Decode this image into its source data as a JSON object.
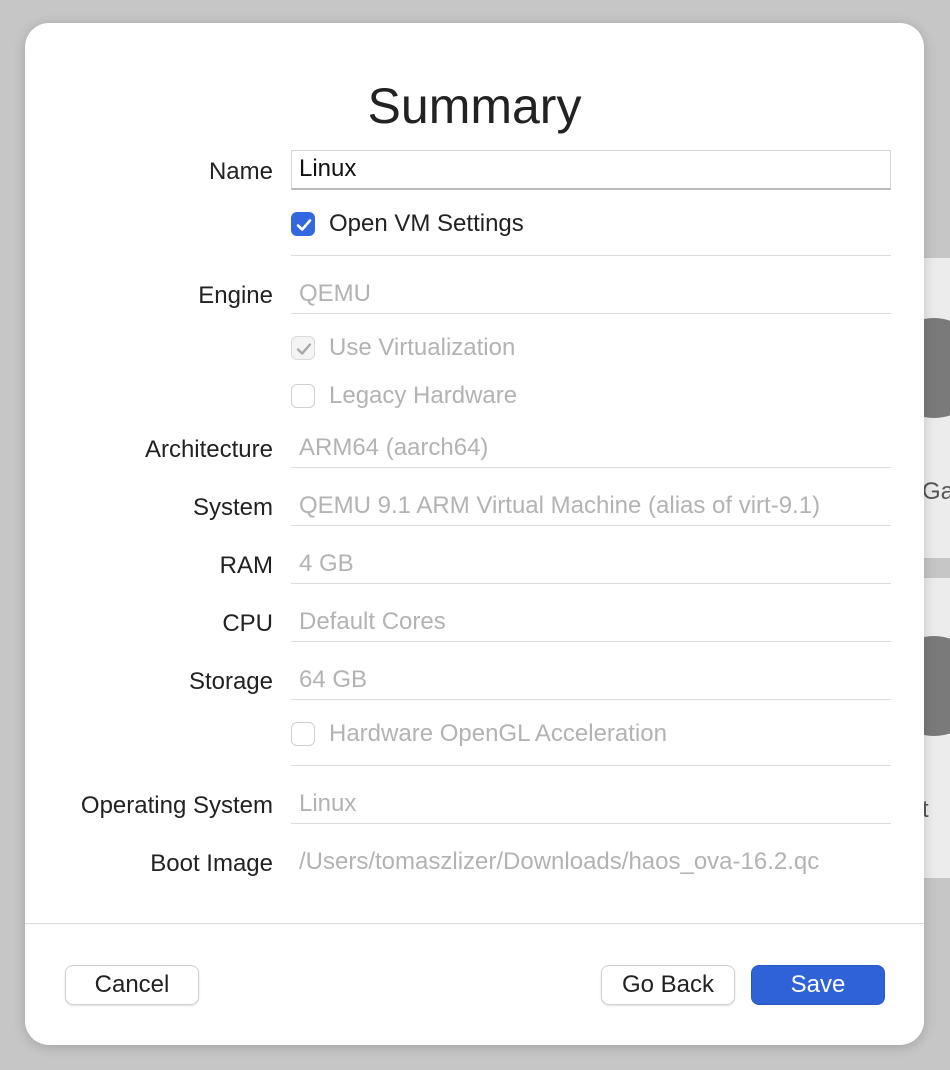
{
  "background": {
    "partial_texts": [
      "Ga",
      "t"
    ]
  },
  "dialog": {
    "title": "Summary",
    "name_label": "Name",
    "name_value": "Linux",
    "open_vm_settings": {
      "label": "Open VM Settings",
      "checked": true
    },
    "engine": {
      "label": "Engine",
      "value": "QEMU"
    },
    "use_virtualization": {
      "label": "Use Virtualization",
      "checked": true,
      "disabled": true
    },
    "legacy_hardware": {
      "label": "Legacy Hardware",
      "checked": false,
      "disabled": true
    },
    "architecture": {
      "label": "Architecture",
      "value": "ARM64 (aarch64)"
    },
    "system": {
      "label": "System",
      "value": "QEMU 9.1 ARM Virtual Machine (alias of virt-9.1)"
    },
    "ram": {
      "label": "RAM",
      "value": "4 GB"
    },
    "cpu": {
      "label": "CPU",
      "value": "Default Cores"
    },
    "storage": {
      "label": "Storage",
      "value": "64 GB"
    },
    "opengl": {
      "label": "Hardware OpenGL Acceleration",
      "checked": false,
      "disabled": true
    },
    "operating_system": {
      "label": "Operating System",
      "value": "Linux"
    },
    "boot_image": {
      "label": "Boot Image",
      "value": "/Users/tomaszlizer/Downloads/haos_ova-16.2.qc"
    }
  },
  "buttons": {
    "cancel": "Cancel",
    "go_back": "Go Back",
    "save": "Save"
  },
  "colors": {
    "accent": "#2f62d6",
    "checkbox_checked": "#3267e0",
    "disabled_text": "#b3b3b3"
  }
}
